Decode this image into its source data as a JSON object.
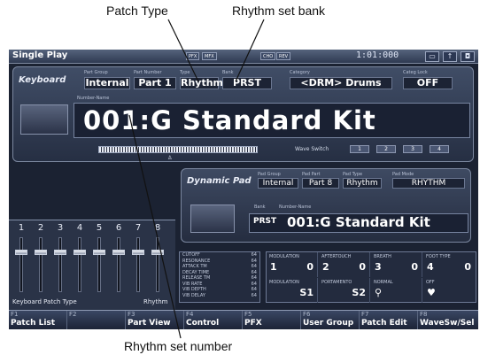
{
  "annotations": {
    "patch_type": "Patch  Type",
    "rhythm_bank": "Rhythm set bank",
    "rhythm_number": "Rhythm set number"
  },
  "titlebar": {
    "title": "Single Play",
    "ind1": "PFX",
    "ind2": "MFX",
    "ind3": "CHO",
    "ind4": "REV",
    "clock": "1:01:000"
  },
  "keyboard": {
    "tag": "Keyboard",
    "part_group_label": "Part Group",
    "part_group": "Internal",
    "part_number_label": "Part Number",
    "part_number": "Part 1",
    "type_label": "Type",
    "type": "Rhythm",
    "bank_label": "Bank",
    "bank": "PRST",
    "category_label": "Category",
    "category": "<DRM> Drums",
    "categ_lock_label": "Categ Lock",
    "categ_lock": "OFF",
    "patch_label": "Number-Name",
    "patch_name": "001:G Standard Kit",
    "wave_switch_label": "Wave Switch",
    "wave_switches": [
      "1",
      "2",
      "3",
      "4"
    ]
  },
  "pad": {
    "tag": "Dynamic Pad",
    "group_label": "Pad Group",
    "group": "Internal",
    "part_label": "Pad Part",
    "part": "Part 8",
    "type_label": "Pad Type",
    "type": "Rhythm",
    "mode_label": "Pad Mode",
    "mode": "RHYTHM",
    "bank_label": "Bank",
    "bank": "PRST",
    "name_label": "Number-Name",
    "patch_name": "001:G Standard Kit"
  },
  "mixer": {
    "channels": [
      "1",
      "2",
      "3",
      "4",
      "5",
      "6",
      "7",
      "8"
    ],
    "footer_label": "Keyboard Patch Type",
    "footer_value": "Rhythm"
  },
  "params": [
    {
      "name": "CUTOFF",
      "value": "64"
    },
    {
      "name": "RESONANCE",
      "value": "64"
    },
    {
      "name": "ATTACK TM",
      "value": "64"
    },
    {
      "name": "DECAY TIME",
      "value": "64"
    },
    {
      "name": "RELEASE TM",
      "value": "64"
    },
    {
      "name": "VIB RATE",
      "value": "64"
    },
    {
      "name": "VIB DEPTH",
      "value": "64"
    },
    {
      "name": "VIB DELAY",
      "value": "64"
    }
  ],
  "assign": {
    "modulation_label": "MODULATION",
    "modulation_a": "1",
    "modulation_b": "0",
    "aftertouch_label": "AFTERTOUCH",
    "aftertouch_a": "2",
    "aftertouch_b": "0",
    "breath_label": "BREATH",
    "breath_a": "3",
    "breath_b": "0",
    "foot_label": "FOOT TYPE",
    "foot_a": "4",
    "foot_b": "0",
    "mod2_label": "MODULATION",
    "mod2_value": "S1",
    "porta_label": "PORTAMENTO",
    "porta_value": "S2",
    "normal_label": "NORMAL",
    "off_label": "OFF"
  },
  "fkeys": [
    {
      "fn": "F1",
      "label": "Patch List"
    },
    {
      "fn": "F2",
      "label": ""
    },
    {
      "fn": "F3",
      "label": "Part View"
    },
    {
      "fn": "F4",
      "label": "Control"
    },
    {
      "fn": "F5",
      "label": "PFX"
    },
    {
      "fn": "F6",
      "label": "User Group"
    },
    {
      "fn": "F7",
      "label": "Patch Edit"
    },
    {
      "fn": "F8",
      "label": "WaveSw/Sel"
    }
  ]
}
